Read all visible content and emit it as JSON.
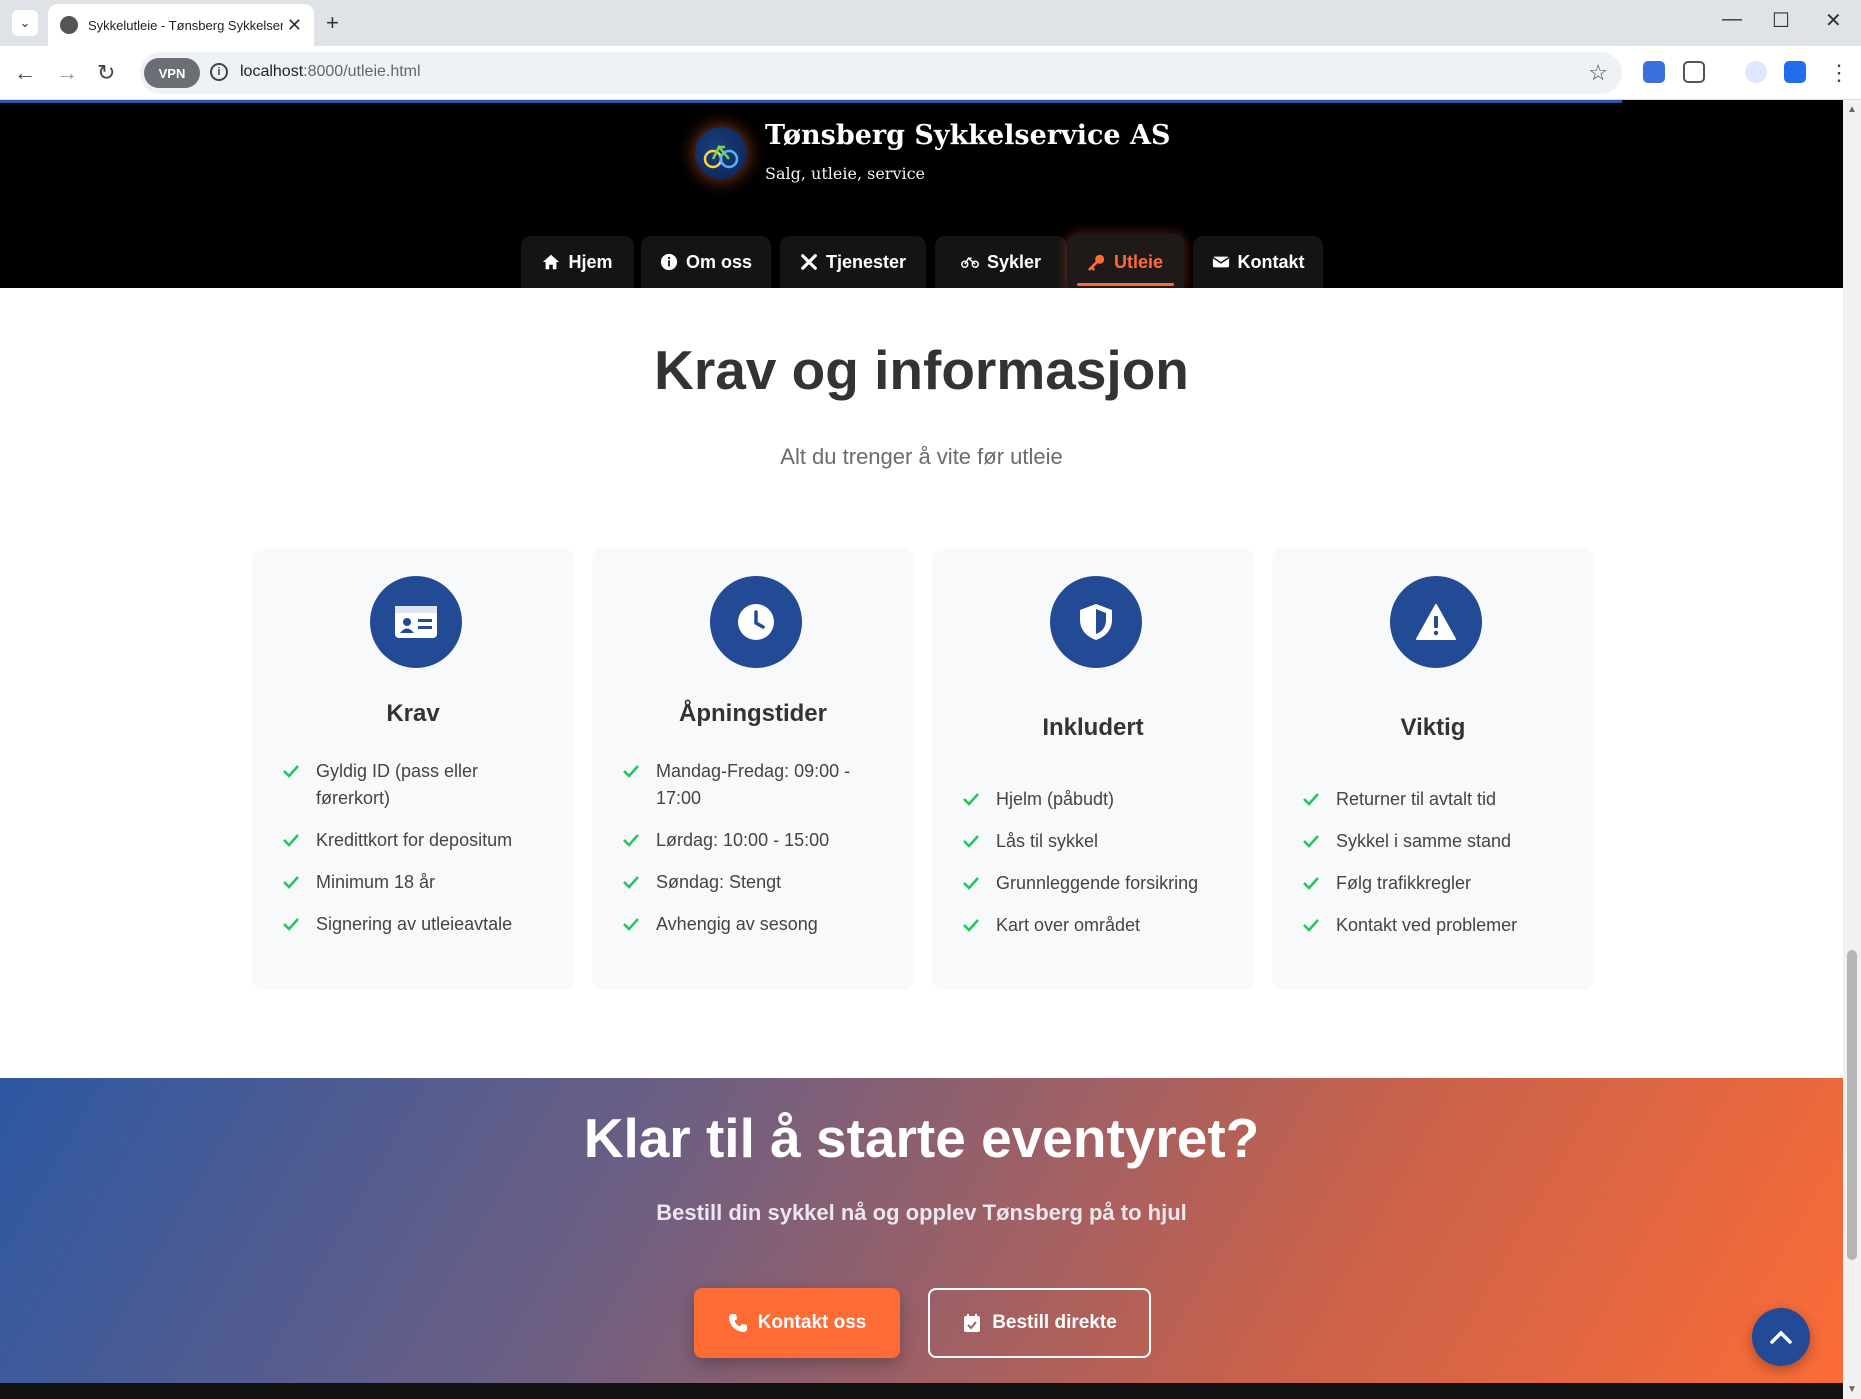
{
  "browser": {
    "tab_title": "Sykkelutleie - Tønsberg Sykkelservice AS",
    "url_host": "localhost",
    "url_rest": ":8000/utleie.html",
    "vpn_label": "VPN"
  },
  "site": {
    "brand": "Tønsberg Sykkelservice AS",
    "tagline": "Salg, utleie, service",
    "nav": [
      {
        "label": "Hjem",
        "icon": "home-icon"
      },
      {
        "label": "Om oss",
        "icon": "info-icon"
      },
      {
        "label": "Tjenester",
        "icon": "tools-icon"
      },
      {
        "label": "Sykler",
        "icon": "bicycle-icon"
      },
      {
        "label": "Utleie",
        "icon": "key-icon",
        "active": true
      },
      {
        "label": "Kontakt",
        "icon": "envelope-icon"
      }
    ]
  },
  "info": {
    "title": "Krav og informasjon",
    "subtitle": "Alt du trenger å vite før utleie",
    "cards": [
      {
        "title": "Krav",
        "icon": "id-card-icon",
        "items": [
          "Gyldig ID (pass eller førerkort)",
          "Kredittkort for depositum",
          "Minimum 18 år",
          "Signering av utleieavtale"
        ]
      },
      {
        "title": "Åpningstider",
        "icon": "clock-icon",
        "items": [
          "Mandag-Fredag: 09:00 - 17:00",
          "Lørdag: 10:00 - 15:00",
          "Søndag: Stengt",
          "Avhengig av sesong"
        ]
      },
      {
        "title": "Inkludert",
        "icon": "shield-icon",
        "items": [
          "Hjelm (påbudt)",
          "Lås til sykkel",
          "Grunnleggende forsikring",
          "Kart over området"
        ]
      },
      {
        "title": "Viktig",
        "icon": "warning-icon",
        "items": [
          "Returner til avtalt tid",
          "Sykkel i samme stand",
          "Følg trafikkregler",
          "Kontakt ved problemer"
        ]
      }
    ]
  },
  "cta": {
    "title": "Klar til å starte eventyret?",
    "subtitle": "Bestill din sykkel nå og opplev Tønsberg på to hjul",
    "primary_label": "Kontakt oss",
    "secondary_label": "Bestill direkte"
  },
  "colors": {
    "accent": "#ff6b35",
    "brand_blue": "#234a94",
    "check_green": "#22c55e"
  }
}
